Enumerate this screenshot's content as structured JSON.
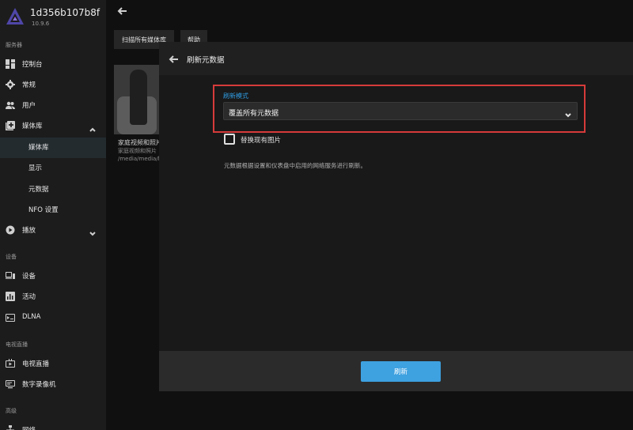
{
  "server": {
    "name": "1d356b107b8f",
    "version": "10.9.6"
  },
  "sidebar": {
    "sections": {
      "server": "服务器",
      "devices": "设备",
      "livetv": "电视直播",
      "advanced": "高级"
    },
    "items": [
      {
        "label": "控制台",
        "icon": "dashboard-icon"
      },
      {
        "label": "常规",
        "icon": "gear-icon"
      },
      {
        "label": "用户",
        "icon": "users-icon"
      },
      {
        "label": "媒体库",
        "icon": "library-icon"
      },
      {
        "label": "媒体库"
      },
      {
        "label": "显示"
      },
      {
        "label": "元数据"
      },
      {
        "label": "NFO 设置"
      },
      {
        "label": "播放",
        "icon": "play-circle-icon"
      },
      {
        "label": "设备",
        "icon": "devices-icon"
      },
      {
        "label": "活动",
        "icon": "activity-icon"
      },
      {
        "label": "DLNA",
        "icon": "dlna-icon"
      },
      {
        "label": "电视直播",
        "icon": "tv-icon"
      },
      {
        "label": "数字录像机",
        "icon": "dvr-icon"
      },
      {
        "label": "网络",
        "icon": "network-icon"
      }
    ]
  },
  "toolbar": {
    "scan_all": "扫描所有媒体库",
    "help": "帮助"
  },
  "library_card": {
    "title": "家庭视频和照片",
    "subtitle": "家庭视频和照片",
    "path": "/media/media/lib"
  },
  "dialog": {
    "title": "刷新元数据",
    "mode_label": "刷新模式",
    "mode_value": "覆盖所有元数据",
    "replace_images_label": "替换现有图片",
    "replace_images_checked": false,
    "description": "元数据根据设置和仪表盘中启用的网络服务进行刷新。",
    "refresh_button": "刷新"
  },
  "colors": {
    "accent": "#3ea1e0",
    "highlight_border": "#d63a3a"
  }
}
